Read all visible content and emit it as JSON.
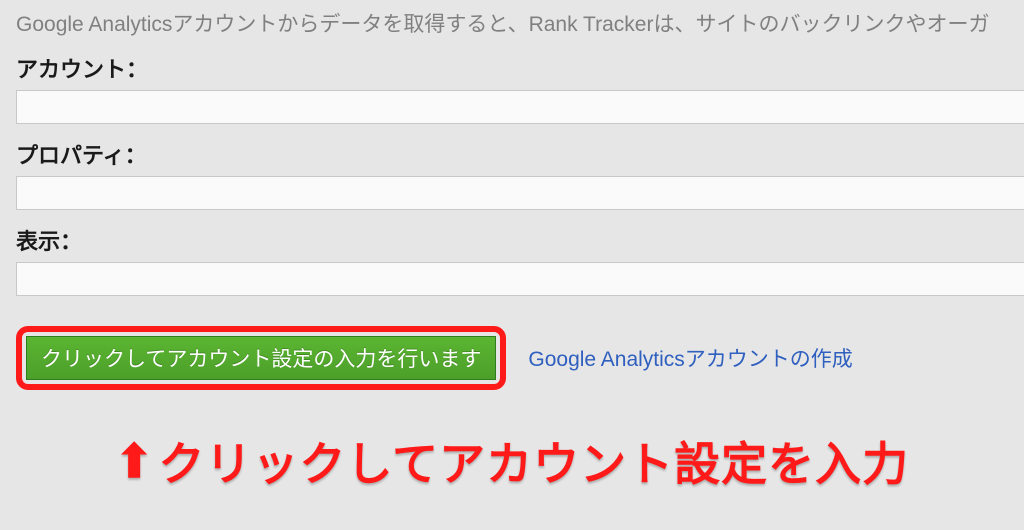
{
  "intro": "Google Analyticsアカウントからデータを取得すると、Rank Trackerは、サイトのバックリンクやオーガ",
  "fields": {
    "account": {
      "label": "アカウント：",
      "value": ""
    },
    "property": {
      "label": "プロパティ：",
      "value": ""
    },
    "view": {
      "label": "表示：",
      "value": ""
    }
  },
  "buttons": {
    "enter_settings": "クリックしてアカウント設定の入力を行います",
    "create_ga_account": "Google Analyticsアカウントの作成"
  },
  "annotation": {
    "arrow": "⬆",
    "text": "クリックしてアカウント設定を入力"
  }
}
